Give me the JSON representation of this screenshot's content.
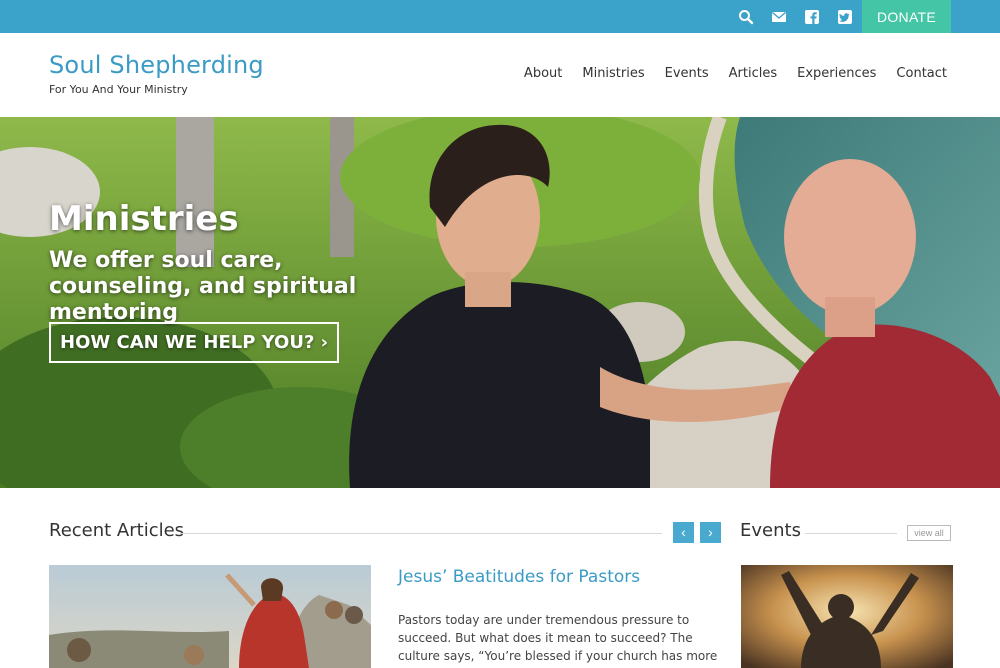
{
  "topbar": {
    "icons": [
      "search-icon",
      "envelope-icon",
      "facebook-icon",
      "twitter-icon"
    ],
    "donate_label": "DONATE",
    "colors": {
      "bar": "#3ba2c9",
      "donate": "#44c6a6"
    }
  },
  "brand": {
    "title": "Soul Shepherding",
    "tagline": "For You And Your Ministry"
  },
  "nav": {
    "items": [
      "About",
      "Ministries",
      "Events",
      "Articles",
      "Experiences",
      "Contact"
    ]
  },
  "hero": {
    "title": "Ministries",
    "subtitle": "We offer soul care, counseling, and spiritual mentoring",
    "cta_label": "HOW CAN WE HELP YOU? ›"
  },
  "recent_articles": {
    "heading": "Recent Articles",
    "prev_icon": "chevron-left-icon",
    "next_icon": "chevron-right-icon",
    "prev_glyph": "‹",
    "next_glyph": "›",
    "article": {
      "title": "Jesus’ Beatitudes for Pastors",
      "excerpt": "Pastors today are under tremendous pressure to succeed. But what does it mean to succeed? The culture says, “You’re blessed if your church has more and more"
    }
  },
  "events": {
    "heading": "Events",
    "view_all_label": "view all"
  },
  "accent_color": "#3b9bc5"
}
